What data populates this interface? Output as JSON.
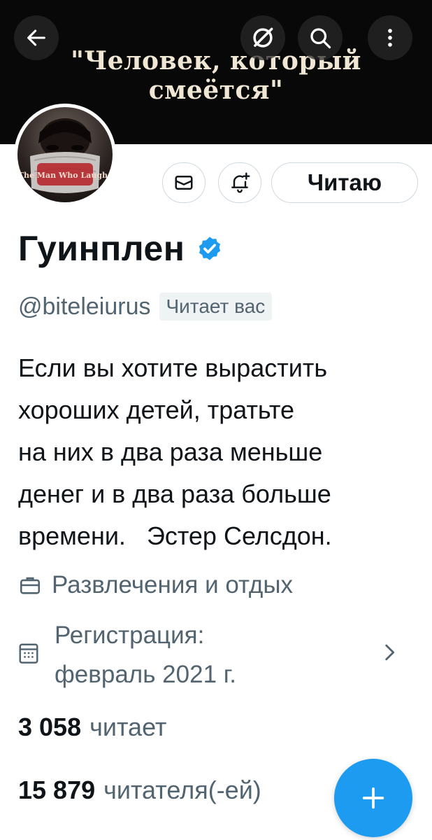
{
  "banner": {
    "text": "\"Человек, который смеётся\""
  },
  "topbar": {
    "back_icon": "arrow-left-icon",
    "grok_icon": "grok-slash-icon",
    "search_icon": "search-icon",
    "more_icon": "more-vertical-icon"
  },
  "profile": {
    "avatar_text": "The Man Who Laughs",
    "name": "Гуинплен",
    "verified": true,
    "handle": "@biteleiurus",
    "follows_you": "Читает вас",
    "bio": "Если вы хотите вырастить\nхороших детей, тратьте\nна них в два раза меньше\nденег и в два раза больше\nвремени.   Эстер Селсдон.",
    "category": "Развлечения и отдых",
    "joined": "Регистрация:\nфевраль 2021 г."
  },
  "actions": {
    "follow_label": "Читаю",
    "mail_icon": "mail-icon",
    "bell_icon": "bell-plus-icon"
  },
  "stats": {
    "following_count": "3 058",
    "following_label": "читает",
    "followers_count": "15 879",
    "followers_label": "читателя(-ей)"
  },
  "colors": {
    "accent": "#1d9bf0",
    "text_primary": "#0f1419",
    "text_secondary": "#536471",
    "banner_bg": "#080808"
  },
  "fab": {
    "icon": "plus-icon"
  }
}
